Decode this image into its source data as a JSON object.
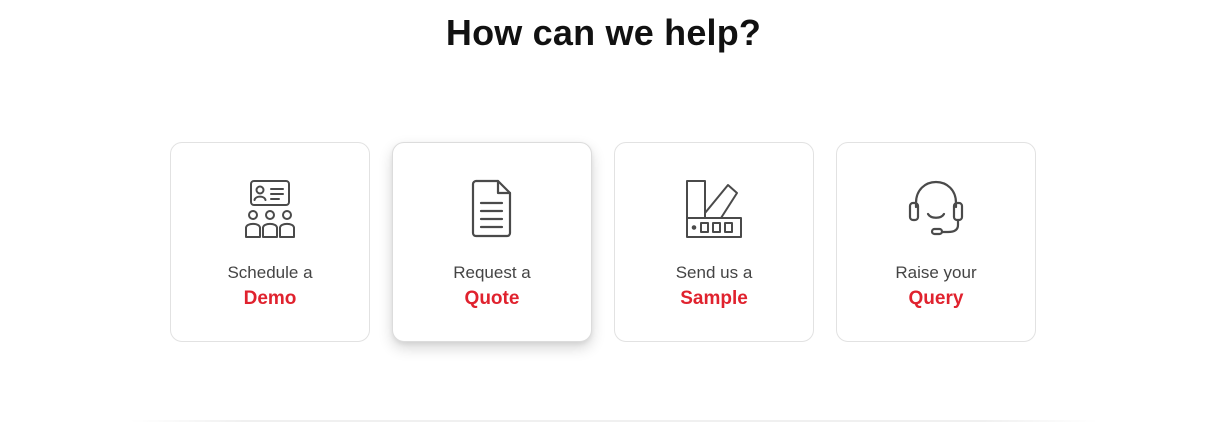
{
  "heading": "How can we help?",
  "colors": {
    "accent": "#e0222e",
    "text": "#444444",
    "icon": "#4a4a4a"
  },
  "cards": [
    {
      "line1": "Schedule a",
      "line2": "Demo",
      "icon": "audience-presentation-icon"
    },
    {
      "line1": "Request a",
      "line2": "Quote",
      "icon": "document-icon"
    },
    {
      "line1": "Send us a",
      "line2": "Sample",
      "icon": "color-swatch-icon"
    },
    {
      "line1": "Raise your",
      "line2": "Query",
      "icon": "headset-icon"
    }
  ]
}
